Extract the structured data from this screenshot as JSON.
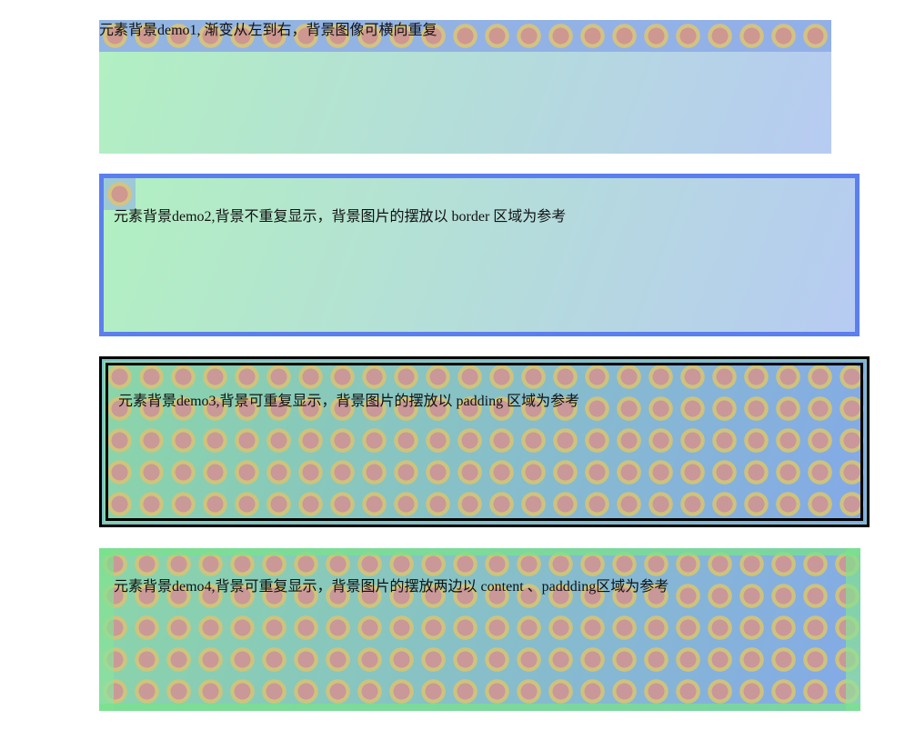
{
  "demos": [
    {
      "text": "元素背景demo1, 渐变从左到右，背景图像可横向重复"
    },
    {
      "text": "元素背景demo2,背景不重复显示，背景图片的摆放以 border 区域为参考"
    },
    {
      "text": "元素背景demo3,背景可重复显示，背景图片的摆放以 padding 区域为参考"
    },
    {
      "text": "元素背景demo4,背景可重复显示，背景图片的摆放两边以 content 、paddding区域为参考"
    }
  ],
  "colors": {
    "gradient_start": "#b2f0c1",
    "gradient_end": "#b7cbf2",
    "demo2_border": "#5b7fef",
    "demo3_border": "#000000",
    "coin_icon_center": "#cd9696",
    "coin_icon_ring": "#d2c378"
  },
  "icons": {
    "background_tile": "coin-icon"
  }
}
